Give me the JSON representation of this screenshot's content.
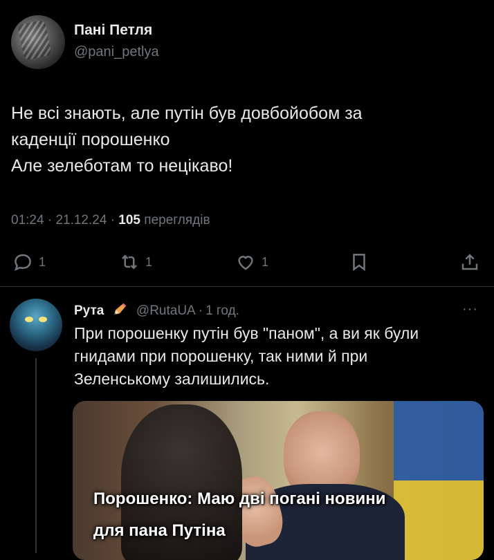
{
  "main_tweet": {
    "author_name": "Пані Петля",
    "author_handle": "@pani_petlya",
    "text_lines": [
      "Не всі знають, але путін був довбойобом за",
      "каденції порошенко",
      "Але зелеботам то нецікаво!"
    ],
    "time": "01:24",
    "date": "21.12.24",
    "views_count": "105",
    "views_label": "переглядів",
    "actions": {
      "reply_count": "1",
      "retweet_count": "1",
      "like_count": "1"
    }
  },
  "reply": {
    "author_name": "Рута",
    "author_handle": "@RutaUA",
    "time_ago": "1 год.",
    "more": "···",
    "text_lines": [
      "При порошенку путін був \"паном\", а ви як були",
      "гнидами при порошенку, так ними й при",
      "Зеленському залишились."
    ],
    "media_caption_lines": [
      "Порошенко: Маю дві погані новини",
      "для пана Путіна"
    ]
  },
  "colors": {
    "background": "#000000",
    "text": "#e7e9ea",
    "secondary": "#71767b",
    "divider": "#2f3336"
  }
}
